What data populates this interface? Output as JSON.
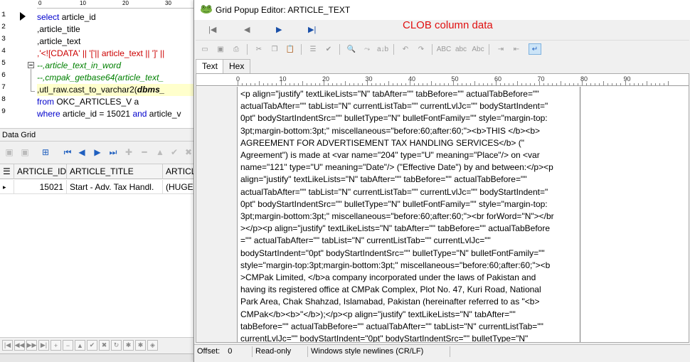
{
  "sql_editor": {
    "ruler_ticks": [
      "0",
      "10",
      "20",
      "30"
    ],
    "line_numbers": [
      "1",
      "2",
      "3",
      "4",
      "5",
      "6",
      "7",
      "8",
      "9"
    ],
    "lines": [
      {
        "a": "select",
        "b": " article_id"
      },
      {
        "a": "         ,article_title"
      },
      {
        "a": "        ,article_text"
      },
      {
        "a": "        ,'<![CDATA' || '['|| article_text || ']' ||"
      },
      {
        "a": "          --,article_text_in_word"
      },
      {
        "a": "        --,cmpak_getbase64(article_text_"
      },
      {
        "a": "        ,utl_raw.cast_to_varchar2(",
        "b": "dbms_"
      },
      {
        "a": "from",
        "b": " OKC_ARTICLES_V a"
      },
      {
        "a": "where",
        "b": " article_id = 15021 ",
        "c": "and",
        "d": " article_v"
      }
    ]
  },
  "data_grid": {
    "title": "Data Grid",
    "columns": [
      "ARTICLE_ID",
      "ARTICLE_TITLE",
      "ARTICLE"
    ],
    "rows": [
      {
        "id": "15021",
        "title": "Start - Adv. Tax Handl.",
        "text": "(HUGECL"
      }
    ]
  },
  "popup": {
    "window_title": "Grid Popup Editor: ARTICLE_TEXT",
    "annotation": "CLOB column data",
    "tabs": [
      "Text",
      "Hex"
    ],
    "ruler_ticks": [
      "0",
      "10",
      "20",
      "30",
      "40",
      "50",
      "60",
      "70",
      "80",
      "90"
    ],
    "content_lines": [
      "<p align=\"justify\" textLikeLists=\"N\" tabAfter=\"\" tabBefore=\"\" actualTabBefore=\"\"",
      "actualTabAfter=\"\" tabList=\"N\" currentListTab=\"\" currentLvlJc=\"\" bodyStartIndent=\"",
      "0pt\" bodyStartIndentSrc=\"\" bulletType=\"N\" bulletFontFamily=\"\" style=\"margin-top:",
      "3pt;margin-bottom:3pt;\" miscellaneous=\"before:60;after:60;\"><b>THIS </b><b>",
      "AGREEMENT FOR ADVERTISEMENT TAX HANDLING SERVICES</b> (\"",
      "Agreement\") is made at <var name=\"204\" type=\"U\" meaning=\"Place\"/> on <var",
      "name=\"121\" type=\"U\" meaning=\"Date\"/> (\"Effective Date\") by and between:</p><p",
      "align=\"justify\" textLikeLists=\"N\" tabAfter=\"\" tabBefore=\"\" actualTabBefore=\"\"",
      "actualTabAfter=\"\" tabList=\"N\" currentListTab=\"\" currentLvlJc=\"\" bodyStartIndent=\"",
      "0pt\" bodyStartIndentSrc=\"\" bulletType=\"N\" bulletFontFamily=\"\" style=\"margin-top:",
      "3pt;margin-bottom:3pt;\" miscellaneous=\"before:60;after:60;\"><br forWord=\"N\"></br",
      "></p><p align=\"justify\" textLikeLists=\"N\" tabAfter=\"\" tabBefore=\"\" actualTabBefore",
      "=\"\" actualTabAfter=\"\" tabList=\"N\" currentListTab=\"\" currentLvlJc=\"\"",
      "bodyStartIndent=\"0pt\" bodyStartIndentSrc=\"\" bulletType=\"N\" bulletFontFamily=\"\"",
      "style=\"margin-top:3pt;margin-bottom:3pt;\" miscellaneous=\"before:60;after:60;\"><b",
      ">CMPak Limited, </b>a company incorporated under the laws of Pakistan and",
      "having its registered office at CMPak Complex, Plot No. 47, Kuri Road, National",
      "Park Area, Chak Shahzad, Islamabad, Pakistan (hereinafter referred to as \"<b>",
      "CMPak</b><b>\"</b>);</p><p align=\"justify\" textLikeLists=\"N\" tabAfter=\"\"",
      "tabBefore=\"\" actualTabBefore=\"\" actualTabAfter=\"\" tabList=\"N\" currentListTab=\"\"",
      "currentLvlJc=\"\" bodyStartIndent=\"0pt\" bodyStartIndentSrc=\"\" bulletType=\"N\""
    ],
    "status": {
      "offset_label": "Offset:",
      "offset_value": "0",
      "mode": "Read-only",
      "newline_style": "Windows style newlines (CR/LF)"
    }
  }
}
